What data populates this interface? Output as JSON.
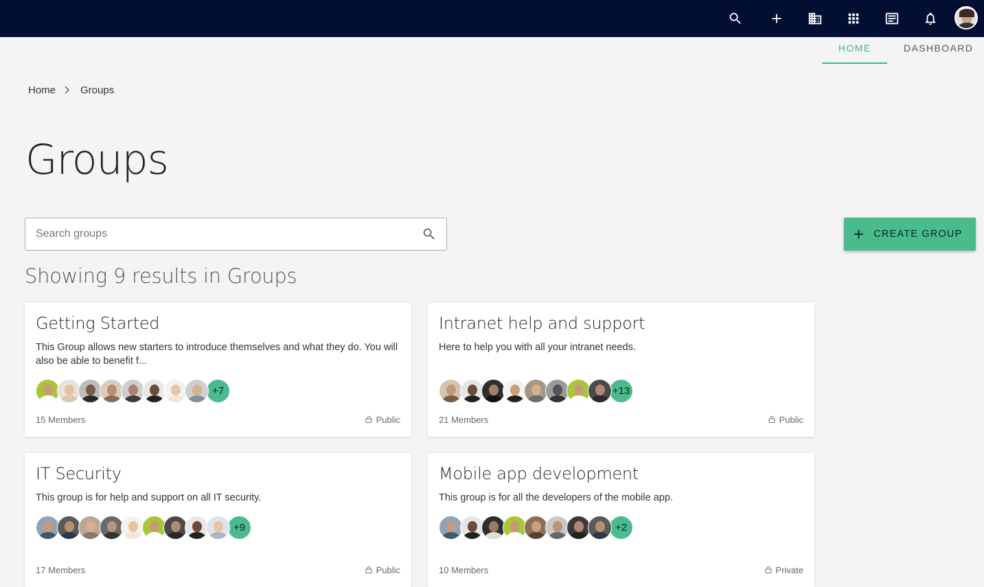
{
  "topbar": {
    "icons": [
      "search-icon",
      "plus-icon",
      "building-icon",
      "apps-grid-icon",
      "news-icon",
      "bell-icon"
    ]
  },
  "tabs": [
    {
      "label": "HOME",
      "active": true
    },
    {
      "label": "DASHBOARD",
      "active": false
    }
  ],
  "breadcrumb": {
    "home": "Home",
    "current": "Groups"
  },
  "page_title": "Groups",
  "search": {
    "placeholder": "Search groups"
  },
  "create_button": {
    "label": "CREATE GROUP"
  },
  "results_text": "Showing 9 results in Groups",
  "colors": {
    "accent": "#49bb8c",
    "topbar": "#020f33",
    "tab_active": "#3db58a"
  },
  "cards": [
    {
      "title": "Getting Started",
      "description": "This Group allows new starters to introduce themselves and what they do. You will also be able to benefit f...",
      "more": "+7",
      "members": "15 Members",
      "privacy": "Public"
    },
    {
      "title": "Intranet help and support",
      "description": "Here to help you with all your intranet needs.",
      "more": "+13",
      "members": "21 Members",
      "privacy": "Public"
    },
    {
      "title": "IT Security",
      "description": "This group is for help and support on all IT security.",
      "more": "+9",
      "members": "17 Members",
      "privacy": "Public"
    },
    {
      "title": "Mobile app development",
      "description": "This group is for all the developers of the mobile app.",
      "more": "+2",
      "members": "10 Members",
      "privacy": "Private"
    }
  ]
}
